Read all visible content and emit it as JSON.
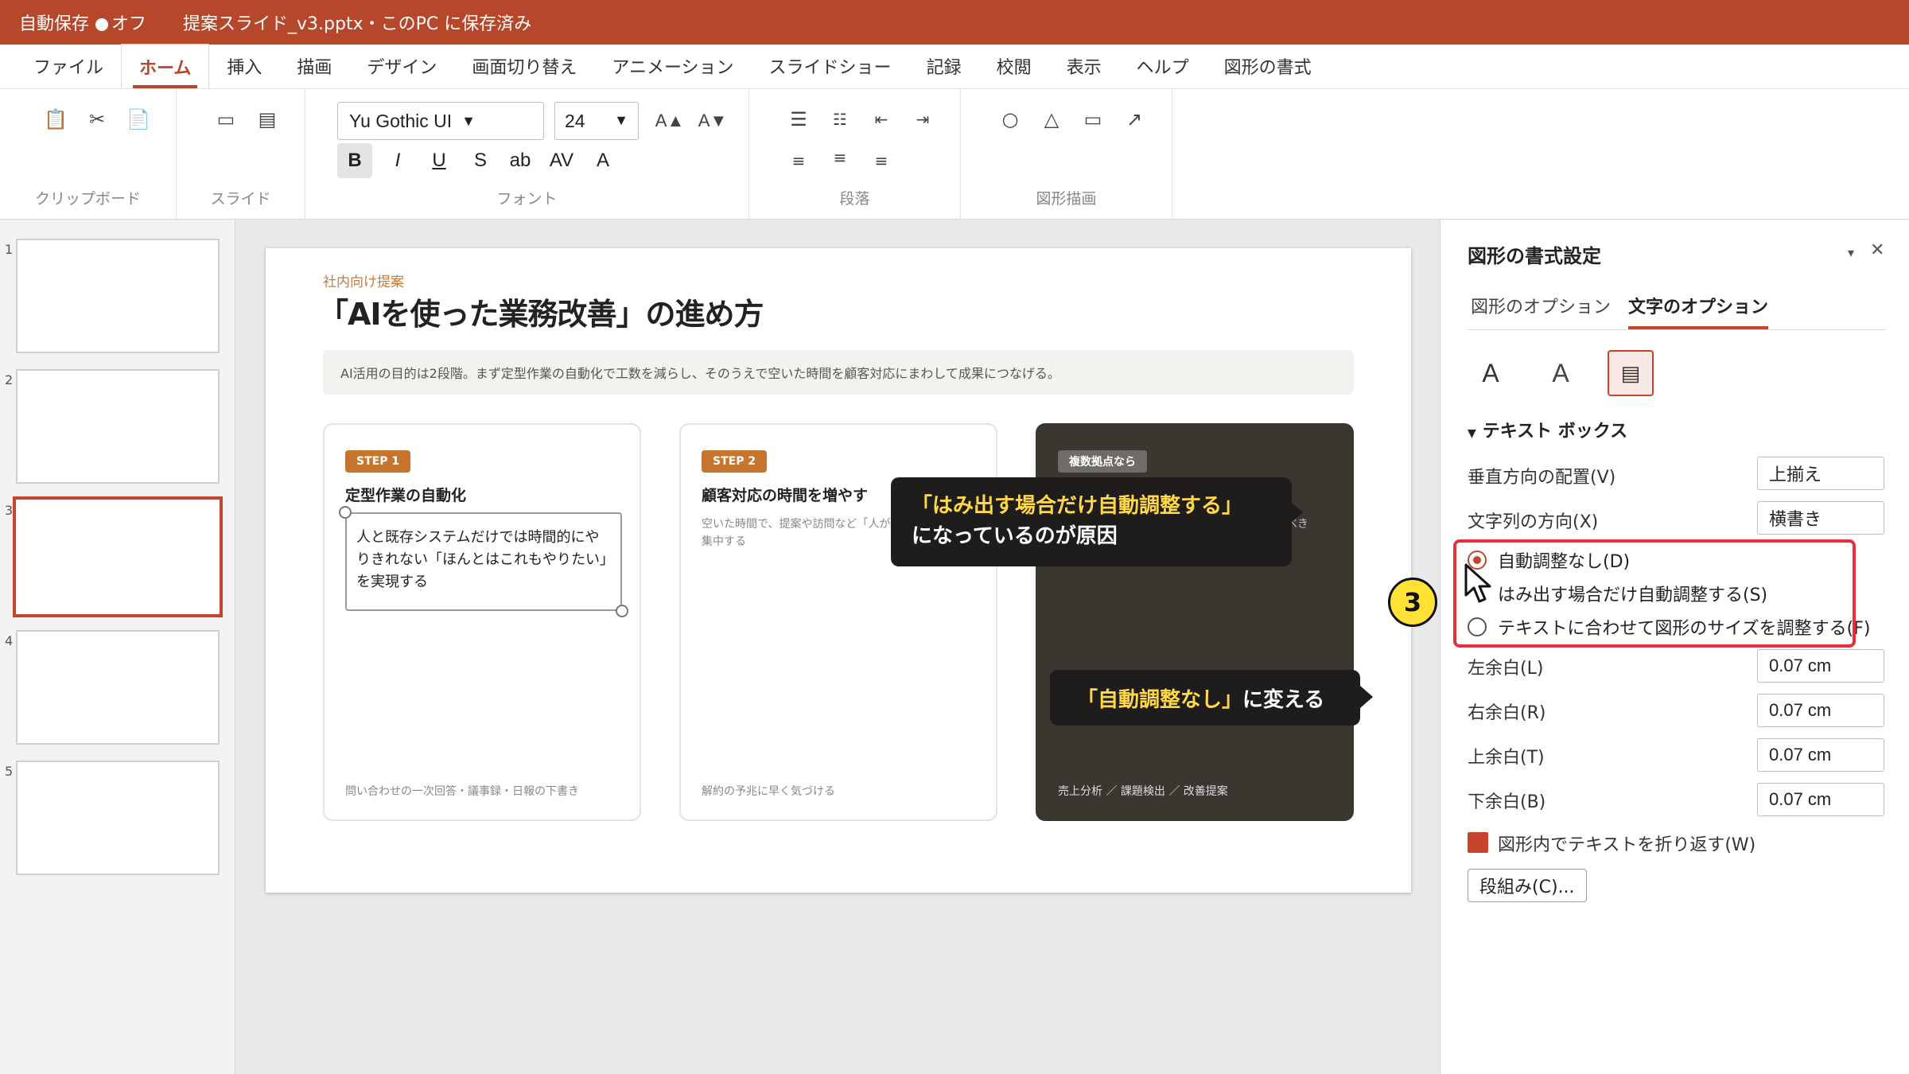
{
  "titlebar": {
    "autosave_label": "自動保存",
    "autosave_state": "オフ",
    "document": "提案スライド_v3.pptx・このPC に保存済み"
  },
  "tabs": [
    "ファイル",
    "ホーム",
    "挿入",
    "描画",
    "デザイン",
    "画面切り替え",
    "アニメーション",
    "スライドショー",
    "記録",
    "校閲",
    "表示",
    "ヘルプ",
    "図形の書式"
  ],
  "ribbon": {
    "groups": {
      "clipboard": "クリップボード",
      "slides": "スライド",
      "font": "フォント",
      "paragraph": "段落",
      "drawing": "図形描画"
    },
    "font_name": "Yu Gothic UI",
    "font_size": "24",
    "font_buttons": [
      "B",
      "I",
      "U",
      "S",
      "ab",
      "AV",
      "A"
    ],
    "grow_font": "A▲",
    "shrink_font": "A▼"
  },
  "thumbnails": [
    "1",
    "2",
    "3",
    "4",
    "5"
  ],
  "slide": {
    "kicker": "社内向け提案",
    "title": "「AIを使った業務改善」の進め方",
    "lead": "AI活用の目的は2段階。まず定型作業の自動化で工数を減らし、そのうえで空いた時間を顧客対応にまわして成果につなげる。",
    "cards": [
      {
        "badge": "STEP 1",
        "title": "定型作業の自動化",
        "textbox": "人と既存システムだけでは時間的にやりきれない「ほんとはこれもやりたい」を実現する",
        "foot": "問い合わせの一次回答・議事録・日報の下書き"
      },
      {
        "badge": "STEP 2",
        "title": "顧客対応の時間を増やす",
        "desc": "空いた時間で、提案や訪問など「人が集中する",
        "foot": "解約の予兆に早く気づける"
      },
      {
        "badge": "複数拠点なら",
        "peek": "すべき",
        "foot": "売上分析 ／ 課題検出 ／ 改善提案"
      }
    ]
  },
  "callouts": {
    "first_highlight": "「はみ出す場合だけ自動調整する」",
    "first_rest": "になっているのが原因",
    "second_highlight": "「自動調整なし」",
    "second_rest": "に変える"
  },
  "pane": {
    "title": "図形の書式設定",
    "tabs": [
      "図形のオプション",
      "文字のオプション"
    ],
    "section": "テキスト ボックス",
    "vertical_align_label": "垂直方向の配置(V)",
    "vertical_align_value": "上揃え",
    "text_direction_label": "文字列の方向(X)",
    "text_direction_value": "横書き",
    "autofit_options": [
      "自動調整なし(D)",
      "はみ出す場合だけ自動調整する(S)",
      "テキストに合わせて図形のサイズを調整する(F)"
    ],
    "autofit_selected": 0,
    "margins": [
      {
        "label": "左余白(L)",
        "value": "0.07 cm"
      },
      {
        "label": "右余白(R)",
        "value": "0.07 cm"
      },
      {
        "label": "上余白(T)",
        "value": "0.07 cm"
      },
      {
        "label": "下余白(B)",
        "value": "0.07 cm"
      }
    ],
    "wrap_label": "図形内でテキストを折り返す(W)",
    "wrap_checked": true,
    "columns_button": "段組み(C)...",
    "step_number": "3"
  },
  "colors": {
    "accent": "#b7472a",
    "selection": "#c6442b",
    "callout_highlight": "#ffd84a",
    "annotation_box": "#e0333c",
    "step_badge": "#c7742c"
  }
}
